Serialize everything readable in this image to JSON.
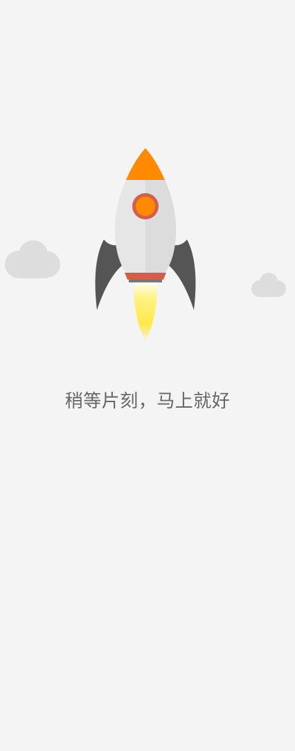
{
  "loading": {
    "message": "稍等片刻，马上就好"
  },
  "illustration": {
    "rocket_icon": "rocket-icon",
    "cloud_icon": "cloud-icon",
    "colors": {
      "background": "#f4f4f4",
      "rocket_nose": "#ff8a00",
      "rocket_body": "#e6e6e6",
      "rocket_window": "#ff8a00",
      "rocket_window_ring": "#d35f4a",
      "rocket_fins": "#555555",
      "rocket_base": "#d35f4a",
      "flame": "#ffe84a",
      "cloud": "#dddddd",
      "text": "#666666"
    }
  }
}
